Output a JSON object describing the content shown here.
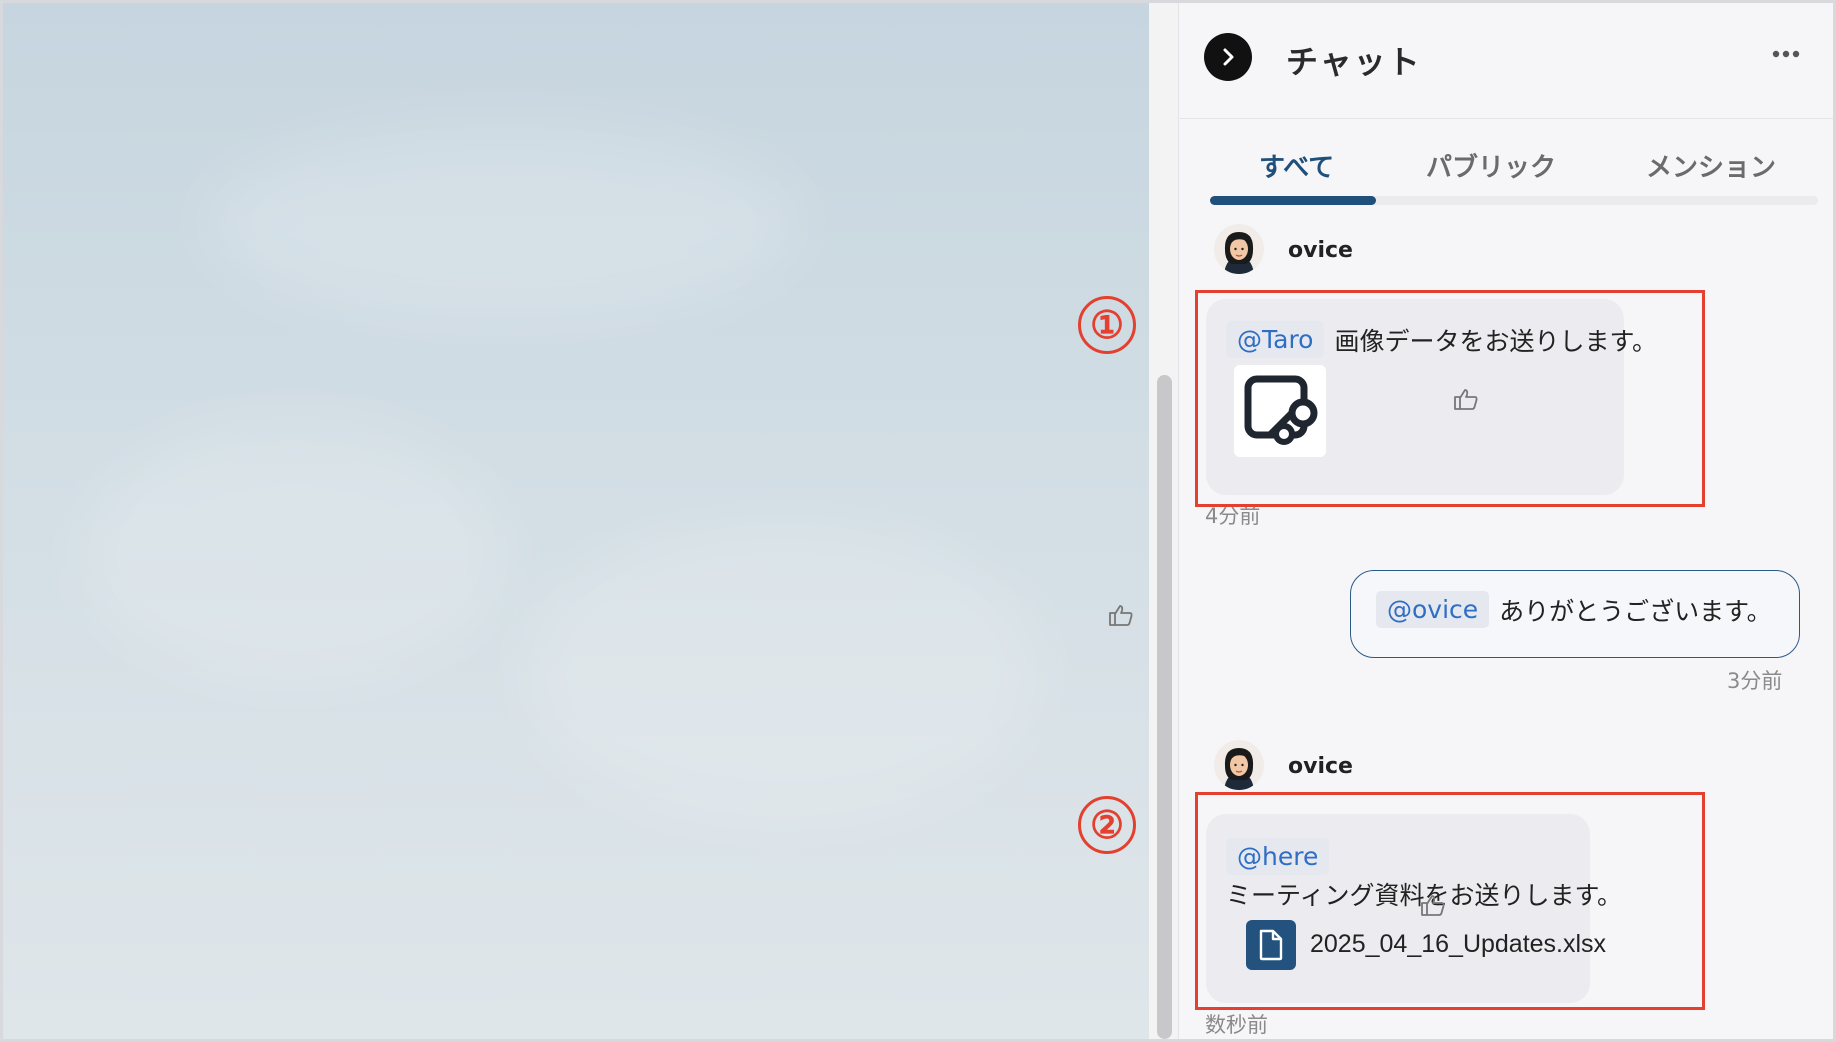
{
  "panel": {
    "title": "チャット"
  },
  "tabs": [
    {
      "label": "すべて",
      "active": true
    },
    {
      "label": "パブリック",
      "active": false
    },
    {
      "label": "メンション",
      "active": false
    }
  ],
  "markers": [
    "①",
    "②"
  ],
  "messages": [
    {
      "sender": "ovice",
      "mention": "@Taro",
      "text": "画像データをお送りします。",
      "attachment_type": "image",
      "timestamp": "4分前"
    },
    {
      "own": true,
      "mention": "@ovice",
      "text": "ありがとうございます。",
      "timestamp": "3分前"
    },
    {
      "sender": "ovice",
      "mention": "@here",
      "text": "ミーティング資料をお送りします。",
      "attachment_type": "file",
      "file_name": "2025_04_16_Updates.xlsx",
      "timestamp": "数秒前"
    }
  ],
  "colors": {
    "accent": "#1f4f7b",
    "mention_text": "#2f6ec5",
    "highlight": "#e3402f"
  },
  "icons": [
    "chevron-right-icon",
    "more-horizontal-icon",
    "thumbs-up-icon",
    "image-icon",
    "file-icon"
  ]
}
